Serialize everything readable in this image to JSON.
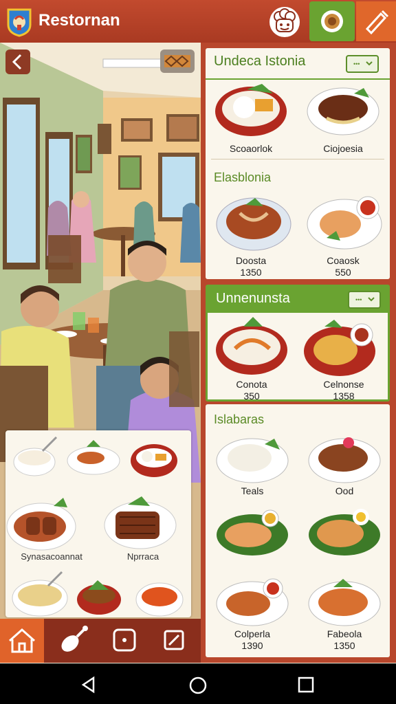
{
  "header": {
    "title": "Restornan"
  },
  "food_card": {
    "labels": [
      "Synasacoannat",
      "Nprraca"
    ]
  },
  "panel": {
    "card1": {
      "title": "Undeca Istonia",
      "dishes": [
        {
          "name": "Scoaorlok"
        },
        {
          "name": "Ciojoesia"
        }
      ],
      "section": "Elasblonia",
      "dishes2": [
        {
          "name": "Doosta",
          "price": "1350"
        },
        {
          "name": "Coaosk",
          "price": "550"
        }
      ]
    },
    "card2": {
      "title": "Unnenunsta",
      "dishes": [
        {
          "name": "Conota",
          "price": "350"
        },
        {
          "name": "Celnonse",
          "price": "1358"
        }
      ]
    },
    "card3": {
      "section": "Islabaras",
      "dishes": [
        {
          "name": "Teals"
        },
        {
          "name": "Ood"
        },
        {
          "name": "Colperla",
          "price": "1390"
        },
        {
          "name": "Fabeola",
          "price": "1350"
        }
      ]
    }
  },
  "colors": {
    "primary": "#b8472c",
    "accent_green": "#6aa331",
    "accent_orange": "#e0672b",
    "title_green": "#4b7f1f"
  },
  "icons": {
    "nav": [
      "home-icon",
      "chicken-leg-icon",
      "dice-icon",
      "edit-icon"
    ],
    "system": [
      "back-triangle-icon",
      "home-circle-icon",
      "recents-square-icon"
    ]
  }
}
